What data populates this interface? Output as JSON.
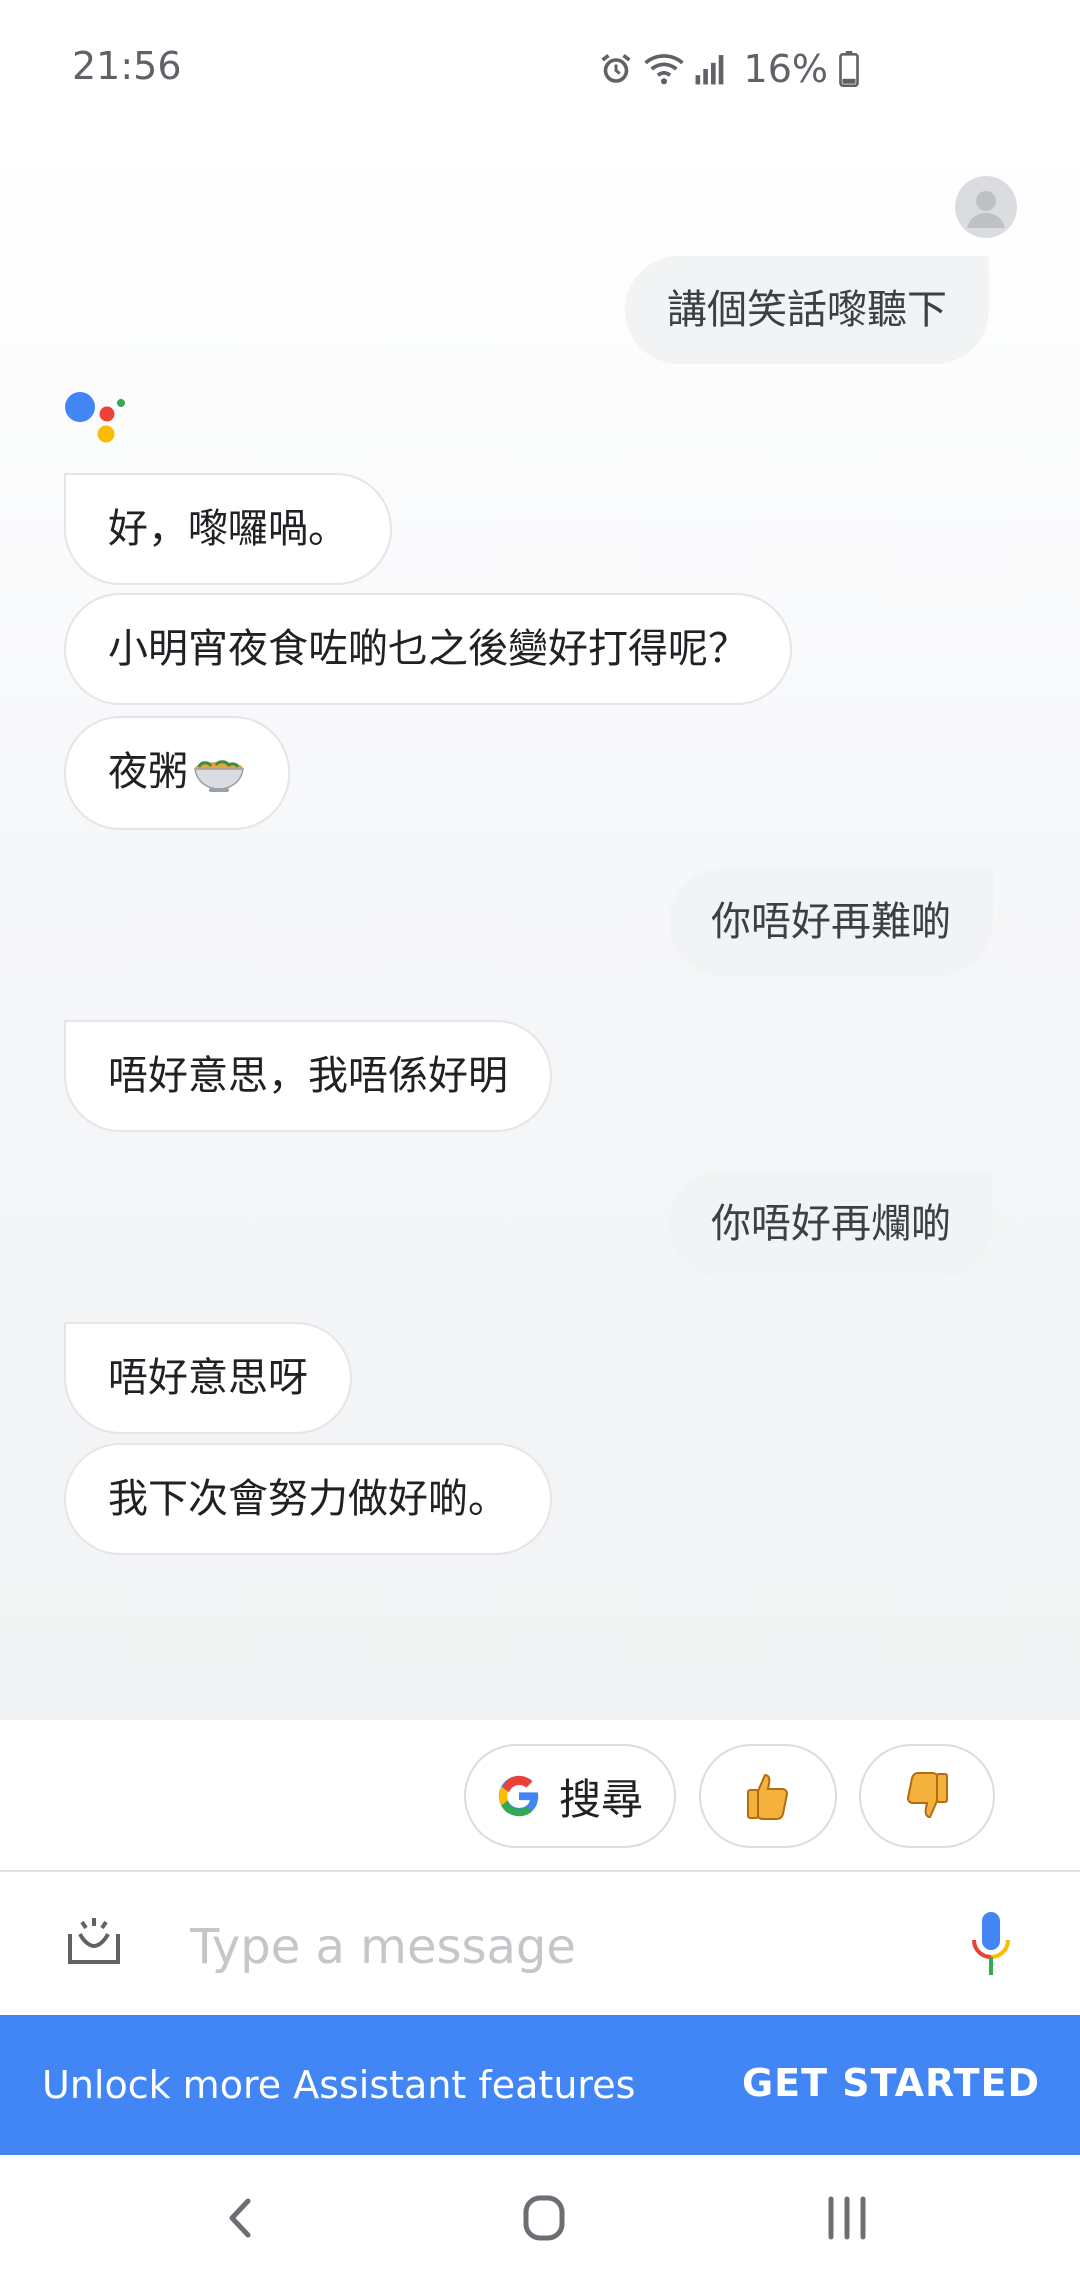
{
  "status_bar": {
    "time": "21:56",
    "battery": "16%",
    "icons": [
      "alarm-icon",
      "wifi-icon",
      "signal-icon",
      "battery-icon"
    ]
  },
  "conversation": {
    "user_1": "講個笑話嚟聽下",
    "assistant_1": [
      "好，嚟囉喎。",
      "小明宵夜食咗啲乜之後變好打得呢？",
      "夜粥"
    ],
    "user_2": "你唔好再難啲",
    "assistant_2": [
      "唔好意思，我唔係好明"
    ],
    "user_3": "你唔好再爛啲",
    "assistant_3": [
      "唔好意思呀",
      "我下次會努力做好啲。"
    ]
  },
  "suggestions": {
    "search_label": "搜尋",
    "thumbs_up_icon": "thumbs-up-icon",
    "thumbs_down_icon": "thumbs-down-icon"
  },
  "input": {
    "placeholder": "Type a message",
    "value": ""
  },
  "banner": {
    "text": "Unlock more Assistant features",
    "button": "GET STARTED"
  },
  "colors": {
    "banner_bg": "#4285f4",
    "google_blue": "#4285f4",
    "google_red": "#ea4335",
    "google_yellow": "#fbbc05",
    "google_green": "#34a853",
    "user_bubble": "#f1f3f4"
  }
}
